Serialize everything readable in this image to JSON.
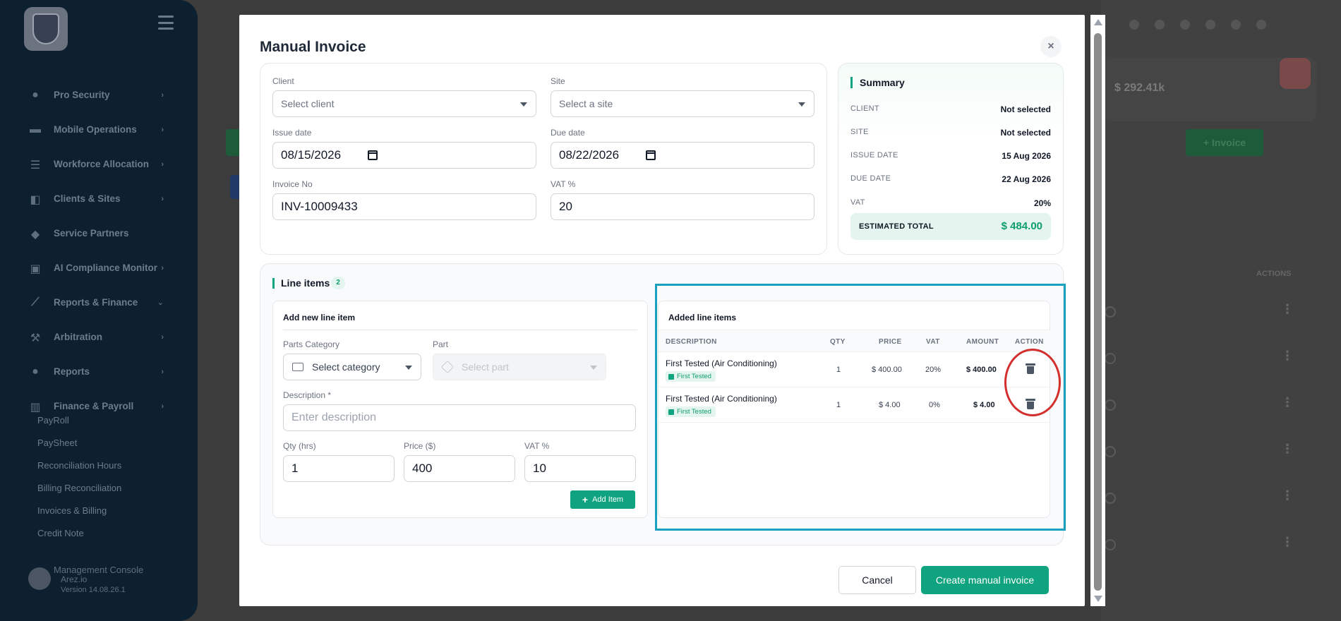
{
  "sidebar": {
    "items": [
      {
        "label": "Pro Security",
        "icon": "user-shield-icon"
      },
      {
        "label": "Mobile Operations",
        "icon": "car-icon"
      },
      {
        "label": "Workforce Allocation",
        "icon": "list-check-icon"
      },
      {
        "label": "Clients & Sites",
        "icon": "clients-icon"
      },
      {
        "label": "Service Partners",
        "icon": "handshake-icon"
      },
      {
        "label": "AI Compliance Monitor",
        "icon": "robot-icon"
      },
      {
        "label": "Reports & Finance",
        "icon": "chart-line-icon"
      },
      {
        "label": "Arbitration",
        "icon": "gavel-icon"
      },
      {
        "label": "Reports",
        "icon": "user-check-icon"
      },
      {
        "label": "Finance & Payroll",
        "icon": "chart-bar-icon"
      }
    ],
    "subitems": [
      "PayRoll",
      "PaySheet",
      "Reconciliation Hours",
      "Billing Reconciliation",
      "Invoices & Billing",
      "Credit Note"
    ],
    "console": {
      "title": "Management Console",
      "name": "Arez.io",
      "version": "Version 14.08.26.1"
    }
  },
  "background": {
    "card_value": "$ 292.41k",
    "invoice_button": "+ Invoice",
    "actions_header": "ACTIONS"
  },
  "modal": {
    "title": "Manual Invoice",
    "close": "×",
    "form": {
      "client_label": "Client",
      "client_placeholder": "Select client",
      "site_label": "Site",
      "site_placeholder": "Select a site",
      "issue_date_label": "Issue date",
      "issue_date_value": "08/15/2026",
      "due_date_label": "Due date",
      "due_date_value": "08/22/2026",
      "invoice_no_label": "Invoice No",
      "invoice_no_value": "INV-10009433",
      "vat_label": "VAT %",
      "vat_value": "20"
    },
    "summary": {
      "title": "Summary",
      "rows": [
        {
          "k": "CLIENT",
          "v": "Not selected"
        },
        {
          "k": "SITE",
          "v": "Not selected"
        },
        {
          "k": "ISSUE DATE",
          "v": "15 Aug 2026"
        },
        {
          "k": "DUE DATE",
          "v": "22 Aug 2026"
        },
        {
          "k": "VAT",
          "v": "20%"
        }
      ],
      "total_label": "ESTIMATED TOTAL",
      "total_value": "$ 484.00"
    },
    "line_items": {
      "title": "Line items",
      "count": "2",
      "add": {
        "title": "Add new line item",
        "parts_category_label": "Parts Category",
        "parts_category_placeholder": "Select category",
        "part_label": "Part",
        "part_placeholder": "Select part",
        "description_label": "Description *",
        "description_placeholder": "Enter description",
        "qty_label": "Qty (hrs)",
        "qty_value": "1",
        "price_label": "Price ($)",
        "price_value": "400",
        "vat_label": "VAT %",
        "vat_value": "10",
        "add_button": "Add Item"
      },
      "added": {
        "title": "Added line items",
        "headers": {
          "description": "DESCRIPTION",
          "qty": "QTY",
          "price": "PRICE",
          "vat": "VAT",
          "amount": "AMOUNT",
          "action": "ACTION"
        },
        "rows": [
          {
            "description": "First Tested (Air Conditioning)",
            "tag": "First Tested",
            "qty": "1",
            "price": "$ 400.00",
            "vat": "20%",
            "amount": "$ 400.00"
          },
          {
            "description": "First Tested (Air Conditioning)",
            "tag": "First Tested",
            "qty": "1",
            "price": "$ 4.00",
            "vat": "0%",
            "amount": "$ 4.00"
          }
        ]
      }
    },
    "buttons": {
      "cancel": "Cancel",
      "create": "Create manual invoice"
    }
  },
  "colors": {
    "accent": "#10a37f",
    "highlight": "#1aa0bf",
    "annotation": "#d32f2f"
  }
}
